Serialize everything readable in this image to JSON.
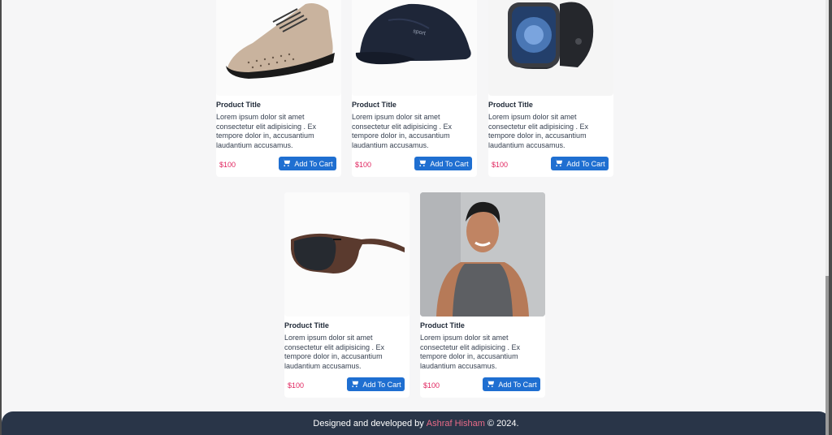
{
  "products": [
    {
      "title": "Product Title",
      "description": "Lorem ipsum dolor sit amet consectetur elit adipisicing . Ex tempore dolor in, accusantium laudantium accusamus.",
      "price": "$100",
      "button": "Add To Cart",
      "image": "sneaker-image"
    },
    {
      "title": "Product Title",
      "description": "Lorem ipsum dolor sit amet consectetur elit adipisicing . Ex tempore dolor in, accusantium laudantium accusamus.",
      "price": "$100",
      "button": "Add To Cart",
      "image": "cap-image"
    },
    {
      "title": "Product Title",
      "description": "Lorem ipsum dolor sit amet consectetur elit adipisicing . Ex tempore dolor in, accusantium laudantium accusamus.",
      "price": "$100",
      "button": "Add To Cart",
      "image": "smartwatch-image"
    },
    {
      "title": "Product Title",
      "description": "Lorem ipsum dolor sit amet consectetur elit adipisicing . Ex tempore dolor in, accusantium laudantium accusamus.",
      "price": "$100",
      "button": "Add To Cart",
      "image": "sunglasses-image"
    },
    {
      "title": "Product Title",
      "description": "Lorem ipsum dolor sit amet consectetur elit adipisicing . Ex tempore dolor in, accusantium laudantium accusamus.",
      "price": "$100",
      "button": "Add To Cart",
      "image": "tanktop-image"
    }
  ],
  "footer": {
    "prefix": "Designed and developed by",
    "author": "Ashraf Hisham",
    "suffix": "© 2024."
  },
  "colors": {
    "accent": "#1f6fd1",
    "price": "#e0245e",
    "footer_bg": "#293548",
    "author": "#ea6b88"
  }
}
